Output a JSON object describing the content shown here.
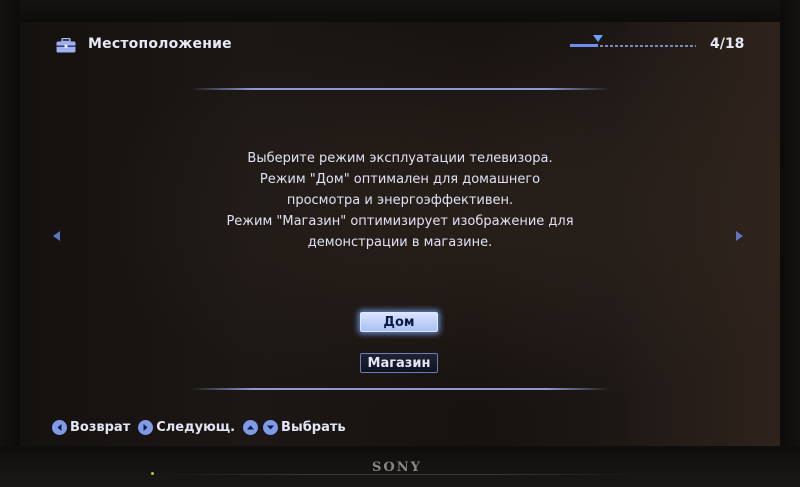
{
  "header": {
    "icon": "toolbox-icon",
    "title": "Местоположение",
    "step_progress": 0.22,
    "page_counter": "4/18"
  },
  "description": {
    "lines": [
      "Выберите режим эксплуатации телевизора.",
      "Режим \"Дом\" оптимален для домашнего",
      "просмотра и энергоэффективен.",
      "Режим \"Магазин\" оптимизирует изображение для",
      "демонстрации в магазине."
    ]
  },
  "options": {
    "home_label": "Дом",
    "store_label": "Магазин",
    "selected": "home"
  },
  "footer": {
    "back_label": "Возврат",
    "next_label": "Следующ.",
    "select_label": "Выбрать"
  },
  "brand": "SONY",
  "colors": {
    "accent": "#7f9ae6",
    "selected_button": "#b8ccf8",
    "text": "#e2e6f4"
  }
}
